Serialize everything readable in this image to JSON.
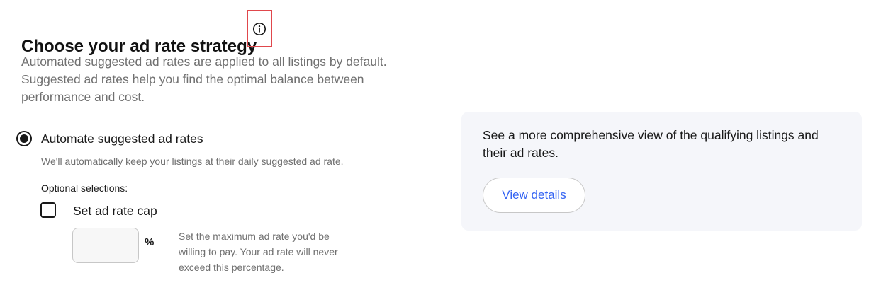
{
  "header": {
    "title": "Choose your ad rate strategy",
    "info_icon": "info-icon"
  },
  "intro": {
    "text": "Automated suggested ad rates are applied to all listings by default. Suggested ad rates help you find the optimal balance between performance and cost."
  },
  "strategy": {
    "selected": true,
    "label": "Automate suggested ad rates",
    "description": "We'll automatically keep your listings at their daily suggested ad rate.",
    "optional_label": "Optional selections:",
    "cap": {
      "checked": false,
      "label": "Set ad rate cap",
      "value": "",
      "unit": "%",
      "help": "Set the maximum ad rate you'd be willing to pay. Your ad rate will never exceed this percentage."
    }
  },
  "details_panel": {
    "text": "See a more comprehensive view of the qualifying listings and their ad rates.",
    "button_label": "View details"
  },
  "colors": {
    "link_blue": "#3665f3",
    "highlight_red": "#e0474c",
    "panel_bg": "#f5f6fa"
  }
}
